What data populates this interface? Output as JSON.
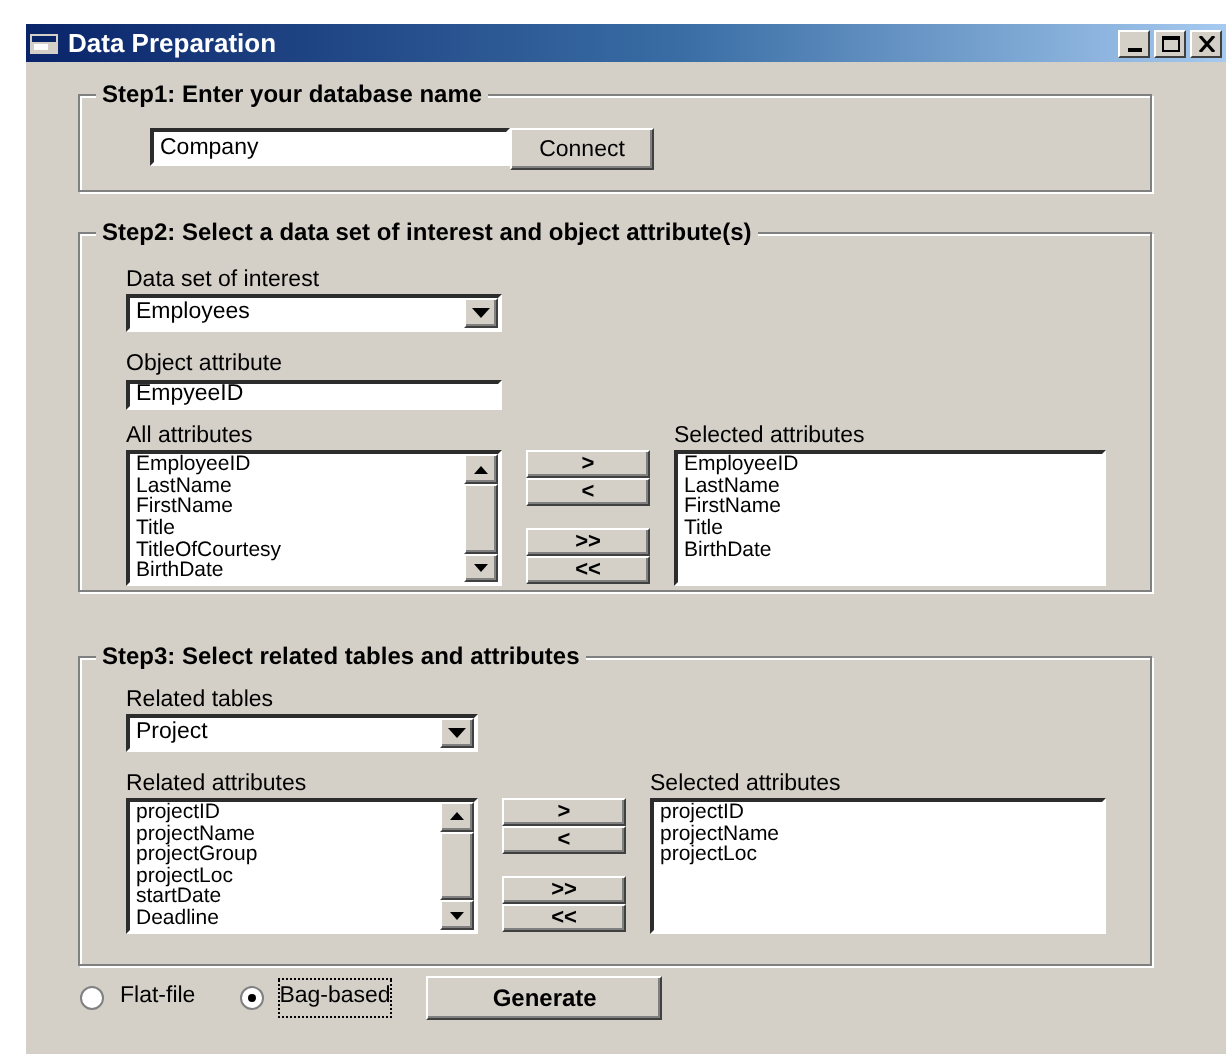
{
  "window": {
    "title": "Data Preparation"
  },
  "step1": {
    "legend": "Step1: Enter your database name",
    "database": {
      "value": "Company"
    },
    "connect_button": "Connect"
  },
  "step2": {
    "legend": "Step2: Select a data set of interest and object attribute(s)",
    "dataset_label": "Data set of interest",
    "dataset": {
      "value": "Employees"
    },
    "object_label": "Object attribute",
    "object_attribute": {
      "value": "EmpyeeID"
    },
    "all_label": "All attributes",
    "all_attributes": [
      "EmployeeID",
      "LastName",
      "FirstName",
      "Title",
      "TitleOfCourtesy",
      "BirthDate"
    ],
    "move_buttons": [
      ">",
      "<",
      ">>",
      "<<"
    ],
    "selected_label": "Selected attributes",
    "selected_attributes": [
      "EmployeeID",
      "LastName",
      "FirstName",
      "Title",
      "BirthDate"
    ]
  },
  "step3": {
    "legend": "Step3: Select related tables and attributes",
    "tables_label": "Related tables",
    "table": {
      "value": "Project"
    },
    "related_label": "Related attributes",
    "related_attributes": [
      "projectID",
      "projectName",
      "projectGroup",
      "projectLoc",
      "startDate",
      "Deadline"
    ],
    "move_buttons": [
      ">",
      "<",
      ">>",
      "<<"
    ],
    "selected_label": "Selected attributes",
    "selected_attributes": [
      "projectID",
      "projectName",
      "projectLoc"
    ]
  },
  "output_format": [
    {
      "label": "Flat-file",
      "selected": false
    },
    {
      "label": "Bag-based",
      "selected": true
    }
  ],
  "generate_button": "Generate"
}
